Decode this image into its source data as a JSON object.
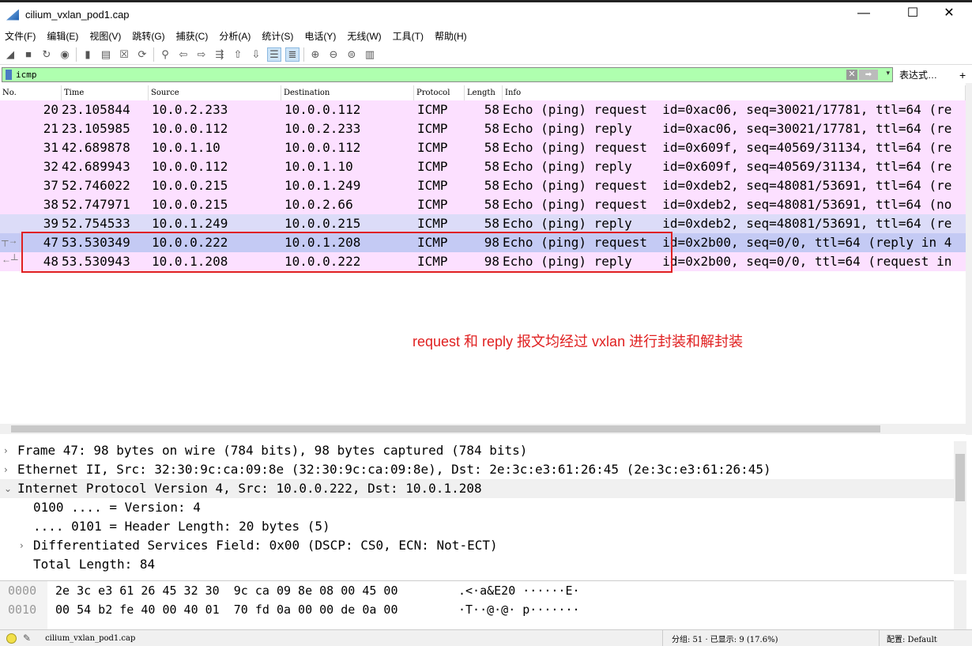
{
  "window": {
    "title": "cilium_vxlan_pod1.cap",
    "minimize": "—",
    "maximize": "☐",
    "close": "✕"
  },
  "menu": [
    "文件(F)",
    "编辑(E)",
    "视图(V)",
    "跳转(G)",
    "捕获(C)",
    "分析(A)",
    "统计(S)",
    "电话(Y)",
    "无线(W)",
    "工具(T)",
    "帮助(H)"
  ],
  "toolbar": [
    {
      "icon": "start-capture-icon",
      "glyph": "◢"
    },
    {
      "icon": "stop-capture-icon",
      "glyph": "■"
    },
    {
      "icon": "restart-capture-icon",
      "glyph": "↻"
    },
    {
      "icon": "capture-options-icon",
      "glyph": "◉"
    },
    {
      "icon": "open-file-icon",
      "glyph": "▮"
    },
    {
      "icon": "save-file-icon",
      "glyph": "▤"
    },
    {
      "icon": "close-file-icon",
      "glyph": "☒"
    },
    {
      "icon": "reload-file-icon",
      "glyph": "⟳"
    },
    {
      "icon": "find-packet-icon",
      "glyph": "⚲"
    },
    {
      "icon": "go-back-icon",
      "glyph": "⇦"
    },
    {
      "icon": "go-forward-icon",
      "glyph": "⇨"
    },
    {
      "icon": "go-to-packet-icon",
      "glyph": "⇶"
    },
    {
      "icon": "first-packet-icon",
      "glyph": "⇧"
    },
    {
      "icon": "last-packet-icon",
      "glyph": "⇩"
    },
    {
      "icon": "auto-scroll-icon",
      "glyph": "☰",
      "active": true
    },
    {
      "icon": "colorize-icon",
      "glyph": "≣",
      "active": true
    },
    {
      "icon": "zoom-in-icon",
      "glyph": "⊕"
    },
    {
      "icon": "zoom-out-icon",
      "glyph": "⊖"
    },
    {
      "icon": "normal-size-icon",
      "glyph": "⊜"
    },
    {
      "icon": "resize-columns-icon",
      "glyph": "▥"
    }
  ],
  "filter": {
    "value": "icmp",
    "expression_label": "表达式…",
    "plus_label": "+",
    "color": "#afffaf"
  },
  "columns": [
    "No.",
    "Time",
    "Source",
    "Destination",
    "Protocol",
    "Length",
    "Info"
  ],
  "packets": [
    {
      "no": "20",
      "time": "23.105844",
      "src": "10.0.2.233",
      "dst": "10.0.0.112",
      "proto": "ICMP",
      "len": "58",
      "info": "Echo (ping) request  id=0xac06, seq=30021/17781, ttl=64 (re"
    },
    {
      "no": "21",
      "time": "23.105985",
      "src": "10.0.0.112",
      "dst": "10.0.2.233",
      "proto": "ICMP",
      "len": "58",
      "info": "Echo (ping) reply    id=0xac06, seq=30021/17781, ttl=64 (re"
    },
    {
      "no": "31",
      "time": "42.689878",
      "src": "10.0.1.10",
      "dst": "10.0.0.112",
      "proto": "ICMP",
      "len": "58",
      "info": "Echo (ping) request  id=0x609f, seq=40569/31134, ttl=64 (re"
    },
    {
      "no": "32",
      "time": "42.689943",
      "src": "10.0.0.112",
      "dst": "10.0.1.10",
      "proto": "ICMP",
      "len": "58",
      "info": "Echo (ping) reply    id=0x609f, seq=40569/31134, ttl=64 (re"
    },
    {
      "no": "37",
      "time": "52.746022",
      "src": "10.0.0.215",
      "dst": "10.0.1.249",
      "proto": "ICMP",
      "len": "58",
      "info": "Echo (ping) request  id=0xdeb2, seq=48081/53691, ttl=64 (re"
    },
    {
      "no": "38",
      "time": "52.747971",
      "src": "10.0.0.215",
      "dst": "10.0.2.66",
      "proto": "ICMP",
      "len": "58",
      "info": "Echo (ping) request  id=0xdeb2, seq=48081/53691, ttl=64 (no"
    },
    {
      "no": "39",
      "time": "52.754533",
      "src": "10.0.1.249",
      "dst": "10.0.0.215",
      "proto": "ICMP",
      "len": "58",
      "info": "Echo (ping) reply    id=0xdeb2, seq=48081/53691, ttl=64 (re"
    },
    {
      "no": "47",
      "time": "53.530349",
      "src": "10.0.0.222",
      "dst": "10.0.1.208",
      "proto": "ICMP",
      "len": "98",
      "info": "Echo (ping) request  id=0x2b00, seq=0/0, ttl=64 (reply in 4"
    },
    {
      "no": "48",
      "time": "53.530943",
      "src": "10.0.1.208",
      "dst": "10.0.0.222",
      "proto": "ICMP",
      "len": "98",
      "info": "Echo (ping) reply    id=0x2b00, seq=0/0, ttl=64 (request in"
    }
  ],
  "annotation": "request 和 reply 报文均经过 vxlan 进行封装和解封装",
  "details": [
    {
      "text": "Frame 47: 98 bytes on wire (784 bits), 98 bytes captured (784 bits)",
      "arrow": "›",
      "indent": 0
    },
    {
      "text": "Ethernet II, Src: 32:30:9c:ca:09:8e (32:30:9c:ca:09:8e), Dst: 2e:3c:e3:61:26:45 (2e:3c:e3:61:26:45)",
      "arrow": "›",
      "indent": 0
    },
    {
      "text": "Internet Protocol Version 4, Src: 10.0.0.222, Dst: 10.0.1.208",
      "arrow": "⌄",
      "indent": 0,
      "highlight": true
    },
    {
      "text": "0100 .... = Version: 4",
      "arrow": "",
      "indent": 1
    },
    {
      "text": ".... 0101 = Header Length: 20 bytes (5)",
      "arrow": "",
      "indent": 1
    },
    {
      "text": "Differentiated Services Field: 0x00 (DSCP: CS0, ECN: Not-ECT)",
      "arrow": "›",
      "indent": 1
    },
    {
      "text": "Total Length: 84",
      "arrow": "",
      "indent": 1
    }
  ],
  "hex": [
    {
      "offset": "0000",
      "bytes": "2e 3c e3 61 26 45 32 30  9c ca 09 8e 08 00 45 00",
      "ascii": ".<·a&E20 ······E·"
    },
    {
      "offset": "0010",
      "bytes": "00 54 b2 fe 40 00 40 01  70 fd 0a 00 00 de 0a 00",
      "ascii": "·T··@·@· p·······"
    }
  ],
  "status": {
    "file": "cilium_vxlan_pod1.cap",
    "packets": "分组: 51 · 已显示: 9 (17.6%)",
    "profile": "配置: Default"
  }
}
